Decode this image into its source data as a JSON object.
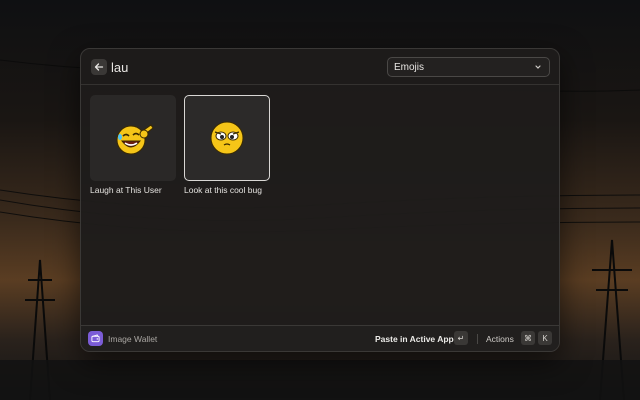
{
  "search": {
    "value": "lau",
    "placeholder": ""
  },
  "filter": {
    "selected": "Emojis"
  },
  "results": [
    {
      "label": "Laugh at This User",
      "icon": "laughing-pointing-emoji-icon",
      "selected": false
    },
    {
      "label": "Look at this cool bug",
      "icon": "wide-eyed-emoji-icon",
      "selected": true
    }
  ],
  "footer": {
    "app_name": "Image Wallet",
    "primary_action": "Paste in Active App",
    "primary_key": "↵",
    "actions_label": "Actions",
    "actions_key_mod": "⌘",
    "actions_key": "K"
  },
  "colors": {
    "accent": "#7b5cd6",
    "emoji_yellow": "#f5c518"
  }
}
